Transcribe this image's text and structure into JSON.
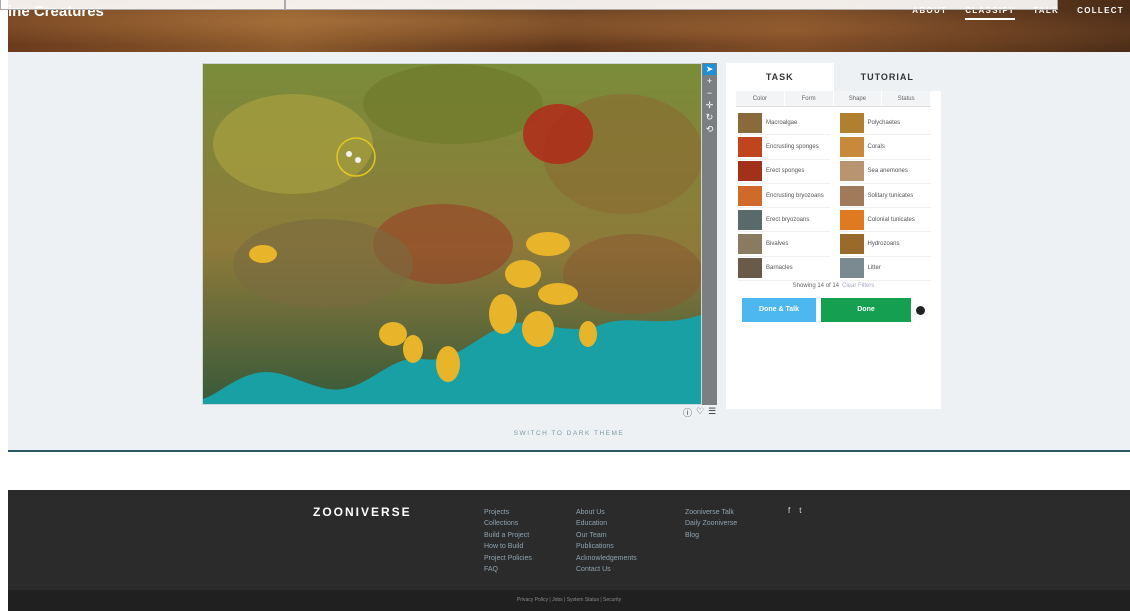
{
  "header": {
    "title": "ine Creatures",
    "nav": [
      "ABOUT",
      "CLASSIFY",
      "TALK",
      "COLLECT"
    ],
    "active_nav": "CLASSIFY"
  },
  "subject_toolbar": {
    "tools": [
      "pointer-icon",
      "plus-icon",
      "minus-icon",
      "plus-icon",
      "rotate-icon",
      "reset-icon"
    ]
  },
  "task_panel": {
    "tabs": [
      "TASK",
      "TUTORIAL"
    ],
    "filters": [
      "Color",
      "Form",
      "Shape",
      "Status"
    ],
    "choices": [
      {
        "label": "Macroalgae",
        "color": "#8a6a3a"
      },
      {
        "label": "Polychaetes",
        "color": "#b08030"
      },
      {
        "label": "Encrusting sponges",
        "color": "#c0441e"
      },
      {
        "label": "Corals",
        "color": "#c88a3a"
      },
      {
        "label": "Erect sponges",
        "color": "#a33018"
      },
      {
        "label": "Sea anemones",
        "color": "#b89470"
      },
      {
        "label": "Encrusting bryozoans",
        "color": "#d06a2a"
      },
      {
        "label": "Solitary tunicates",
        "color": "#a07a5a"
      },
      {
        "label": "Erect bryozoans",
        "color": "#5a6a6a"
      },
      {
        "label": "Colonial tunicates",
        "color": "#e07a20"
      },
      {
        "label": "Bivalves",
        "color": "#8a7a60"
      },
      {
        "label": "Hydrozoans",
        "color": "#9a6a2a"
      },
      {
        "label": "Barnacles",
        "color": "#6a5a4a"
      },
      {
        "label": "Litter",
        "color": "#7a8a90"
      }
    ],
    "showing_text": "Showing 14 of 14",
    "clear_filters": "Clear Filters",
    "done_talk": "Done & Talk",
    "done": "Done"
  },
  "switch_theme": "SWITCH TO DARK THEME",
  "footer": {
    "logo": "ZOONIVERSE",
    "col1": [
      "Projects",
      "Collections",
      "Build a Project",
      "How to Build",
      "Project Policies",
      "FAQ"
    ],
    "col2": [
      "About Us",
      "Education",
      "Our Team",
      "Publications",
      "Acknowledgements",
      "Contact Us"
    ],
    "col3": [
      "Zooniverse Talk",
      "Daily Zooniverse",
      "Blog"
    ],
    "social": [
      "f",
      "t"
    ],
    "legal": "Privacy Policy  |  Jobs  |  System Status  |  Security"
  },
  "colors": {
    "done_talk": "#4db7f0",
    "done": "#14a050",
    "footer_bg": "#2b2b2b",
    "tool_active": "#1f90d6"
  }
}
